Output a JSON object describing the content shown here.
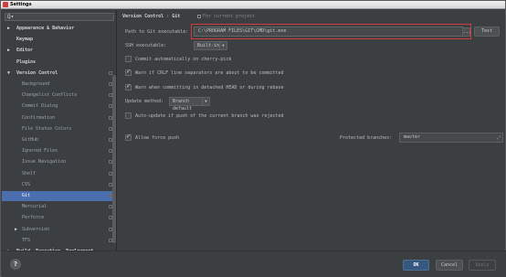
{
  "window": {
    "title": "Settings"
  },
  "search": {
    "placeholder": ""
  },
  "sidebar": {
    "items": [
      {
        "label": "Appearance & Behavior",
        "arrow": "▶",
        "bold": true
      },
      {
        "label": "Keymap",
        "bold": true
      },
      {
        "label": "Editor",
        "arrow": "▶",
        "bold": true
      },
      {
        "label": "Plugins",
        "bold": true
      },
      {
        "label": "Version Control",
        "arrow": "▼",
        "bold": true,
        "proj": true
      },
      {
        "label": "Background",
        "proj": true
      },
      {
        "label": "Changelist Conflicts",
        "proj": true
      },
      {
        "label": "Commit Dialog",
        "proj": true
      },
      {
        "label": "Confirmation",
        "proj": true
      },
      {
        "label": "File Status Colors",
        "proj": true
      },
      {
        "label": "GitHub",
        "proj": true
      },
      {
        "label": "Ignored Files",
        "proj": true
      },
      {
        "label": "Issue Navigation",
        "proj": true
      },
      {
        "label": "Shelf",
        "proj": true
      },
      {
        "label": "CVS",
        "proj": true
      },
      {
        "label": "Git",
        "proj": true,
        "selected": true
      },
      {
        "label": "Mercurial",
        "proj": true
      },
      {
        "label": "Perforce",
        "proj": true
      },
      {
        "label": "Subversion",
        "arrow": "▶",
        "proj": true
      },
      {
        "label": "TFS",
        "proj": true
      },
      {
        "label": "Build, Execution, Deployment",
        "arrow": "▶",
        "bold": true
      }
    ]
  },
  "breadcrumb": {
    "section": "Version Control",
    "separator": "›",
    "page": "Git",
    "project_note": "For current project"
  },
  "git": {
    "path_label": "Path to Git executable:",
    "path_value": "C:\\PROGRAM FILES\\GIT\\CMD\\git.exe",
    "dots_label": "...",
    "test_label": "Test",
    "ssh_label": "SSH executable:",
    "ssh_value": "Built-in",
    "commit_cherry_pick": "Commit automatically on cherry-pick",
    "warn_crlf": "Warn if CRLF line separators are about to be committed",
    "warn_detached": "Warn when committing in detached HEAD or during rebase",
    "update_method_label": "Update method:",
    "update_method_value": "Branch default",
    "auto_update": "Auto-update if push of the current branch was rejected",
    "allow_force_push": "Allow force push",
    "protected_branches_label": "Protected branches:",
    "protected_branches_value": "master",
    "checks": {
      "cherry_pick": false,
      "crlf": true,
      "detached": true,
      "auto_update": false,
      "force_push": true
    }
  },
  "buttons": {
    "help": "?",
    "ok": "OK",
    "cancel": "Cancel",
    "apply": "Apply"
  }
}
